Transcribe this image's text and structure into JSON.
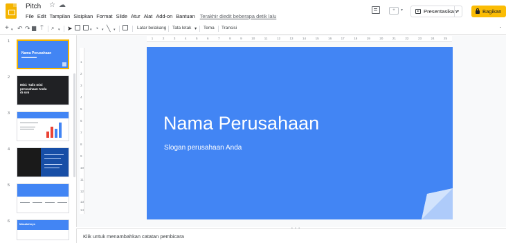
{
  "header": {
    "title": "Pitch",
    "star_icon": "star-icon",
    "cloud_icon": "cloud-status-icon",
    "menus": [
      "File",
      "Edit",
      "Tampilan",
      "Sisipkan",
      "Format",
      "Slide",
      "Atur",
      "Alat",
      "Add-on",
      "Bantuan"
    ],
    "last_edit": "Terakhir diedit beberapa detik lalu",
    "present_label": "Presentasikan",
    "share_label": "Bagikan",
    "share_color": "#fbbc04"
  },
  "toolbar": {
    "plus": "+",
    "undo": "↶",
    "redo": "↷",
    "print": "🖶",
    "format_paint": "⍑",
    "zoom": "🔍",
    "select": "➤",
    "background_label": "Latar belakang",
    "layout_label": "Tata letak",
    "theme_label": "Tema",
    "transition_label": "Transisi"
  },
  "filmstrip": {
    "slide_numbers": [
      "1",
      "2",
      "3",
      "4",
      "5",
      "6"
    ],
    "slide1_title": "Nama Perusahaan",
    "slide2_title": "Misi: Tulis misi perusahaan Anda di sini",
    "slide6_title": "Masalahnya"
  },
  "ruler": {
    "h_marks": [
      "1",
      "2",
      "3",
      "4",
      "5",
      "6",
      "7",
      "8",
      "9",
      "10",
      "11",
      "12",
      "13",
      "14",
      "15",
      "16",
      "17",
      "18",
      "19",
      "20",
      "21",
      "22",
      "23",
      "24",
      "25"
    ],
    "v_marks": [
      "1",
      "2",
      "3",
      "4",
      "5",
      "6",
      "7",
      "8",
      "9",
      "10",
      "11",
      "12",
      "13",
      "14"
    ]
  },
  "slide": {
    "title": "Nama Perusahaan",
    "subtitle": "Slogan perusahaan Anda",
    "background_color": "#4285f4"
  },
  "notes": {
    "placeholder": "Klik untuk menambahkan catatan pembicara"
  }
}
